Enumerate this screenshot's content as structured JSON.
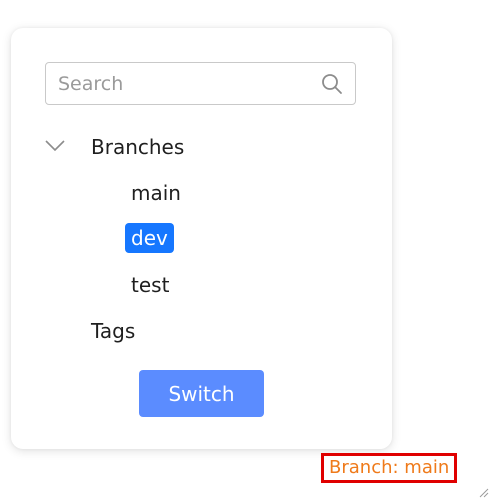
{
  "search": {
    "placeholder": "Search",
    "value": "",
    "icon": "search-icon"
  },
  "tree": {
    "expand_icon": "chevron-down-icon",
    "branches_label": "Branches",
    "branches": [
      {
        "label": "main",
        "selected": false
      },
      {
        "label": "dev",
        "selected": true
      },
      {
        "label": "test",
        "selected": false
      }
    ],
    "tags_label": "Tags"
  },
  "actions": {
    "switch_label": "Switch"
  },
  "status": {
    "branch_text": "Branch: main"
  },
  "colors": {
    "selected_bg": "#1677ff",
    "button_bg": "#5b8cff",
    "status_text": "#ef7a1a",
    "status_border": "#e00000"
  }
}
